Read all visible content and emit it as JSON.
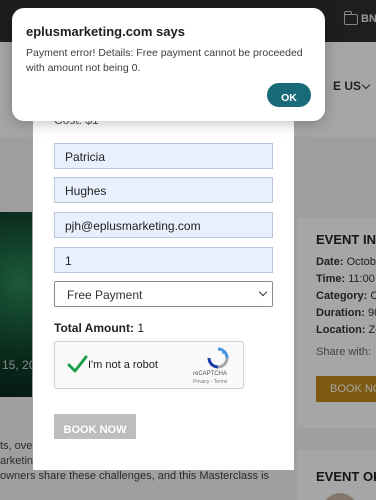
{
  "browser": {
    "bookmarks": [
      {
        "label": ""
      },
      {
        "label": "BNI"
      }
    ]
  },
  "site": {
    "nav_contact": "E US"
  },
  "hero": {
    "date": "15, 20"
  },
  "event_info": {
    "title": "EVENT INF",
    "rows": [
      {
        "label": "Date:",
        "value": " Octobe"
      },
      {
        "label": "Time:",
        "value": " 11:00"
      },
      {
        "label": "Category:",
        "value": " Cl"
      },
      {
        "label": "Duration:",
        "value": " 90"
      },
      {
        "label": "Location:",
        "value": " Zo"
      }
    ],
    "share": "Share with:",
    "book_label": "BOOK NO"
  },
  "body_lines": [
    "ts, over",
    "arketing",
    "owners share these challenges, and this Masterclass is"
  ],
  "organizer": {
    "title": "EVENT OR"
  },
  "form": {
    "cost": "Cost: $1",
    "first_name": "Patricia",
    "last_name": "Hughes",
    "email": "pjh@eplusmarketing.com",
    "quantity": "1",
    "payment_selected": "Free Payment",
    "total_label": "Total Amount:",
    "total_value": " 1",
    "captcha_label": "I'm not a robot",
    "captcha_brand": "reCAPTCHA",
    "captcha_links": "Privacy - Terms",
    "book_button": "BOOK NOW"
  },
  "alert": {
    "title": "eplusmarketing.com says",
    "message": "Payment error! Details: Free payment cannot be proceeded with amount not being 0.",
    "ok_label": "OK"
  },
  "colors": {
    "ok_button": "#1a6b79",
    "field_bg": "#e8effd",
    "book_side": "#c28a1a",
    "check_green": "#1e9e4a"
  }
}
